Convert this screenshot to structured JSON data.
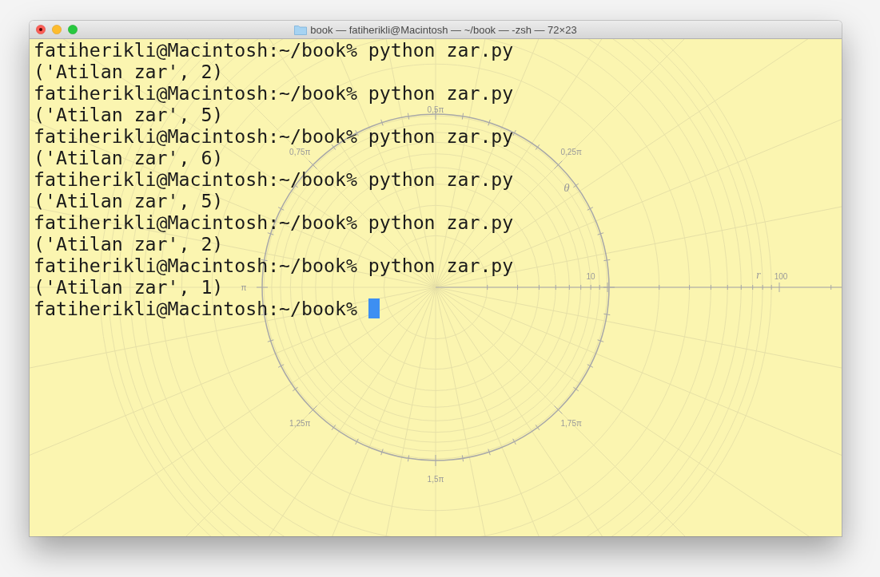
{
  "window": {
    "title": "book — fatiherikli@Macintosh — ~/book — -zsh — 72×23"
  },
  "terminal": {
    "lines": [
      "fatiherikli@Macintosh:~/book% python zar.py",
      "('Atilan zar', 2)",
      "fatiherikli@Macintosh:~/book% python zar.py",
      "('Atilan zar', 5)",
      "fatiherikli@Macintosh:~/book% python zar.py",
      "('Atilan zar', 6)",
      "fatiherikli@Macintosh:~/book% python zar.py",
      "('Atilan zar', 5)",
      "fatiherikli@Macintosh:~/book% python zar.py",
      "('Atilan zar', 2)",
      "fatiherikli@Macintosh:~/book% python zar.py",
      "('Atilan zar', 1)"
    ],
    "prompt": "fatiherikli@Macintosh:~/book% ",
    "cursor": true
  },
  "polar_grid": {
    "angle_labels": [
      "0,25π",
      "0,5π",
      "0,75π",
      "π",
      "1,25π",
      "1,5π",
      "1,75π"
    ],
    "angle_axis_label": "θ",
    "radius_labels": [
      "10",
      "100"
    ],
    "radius_axis_label": "r"
  }
}
